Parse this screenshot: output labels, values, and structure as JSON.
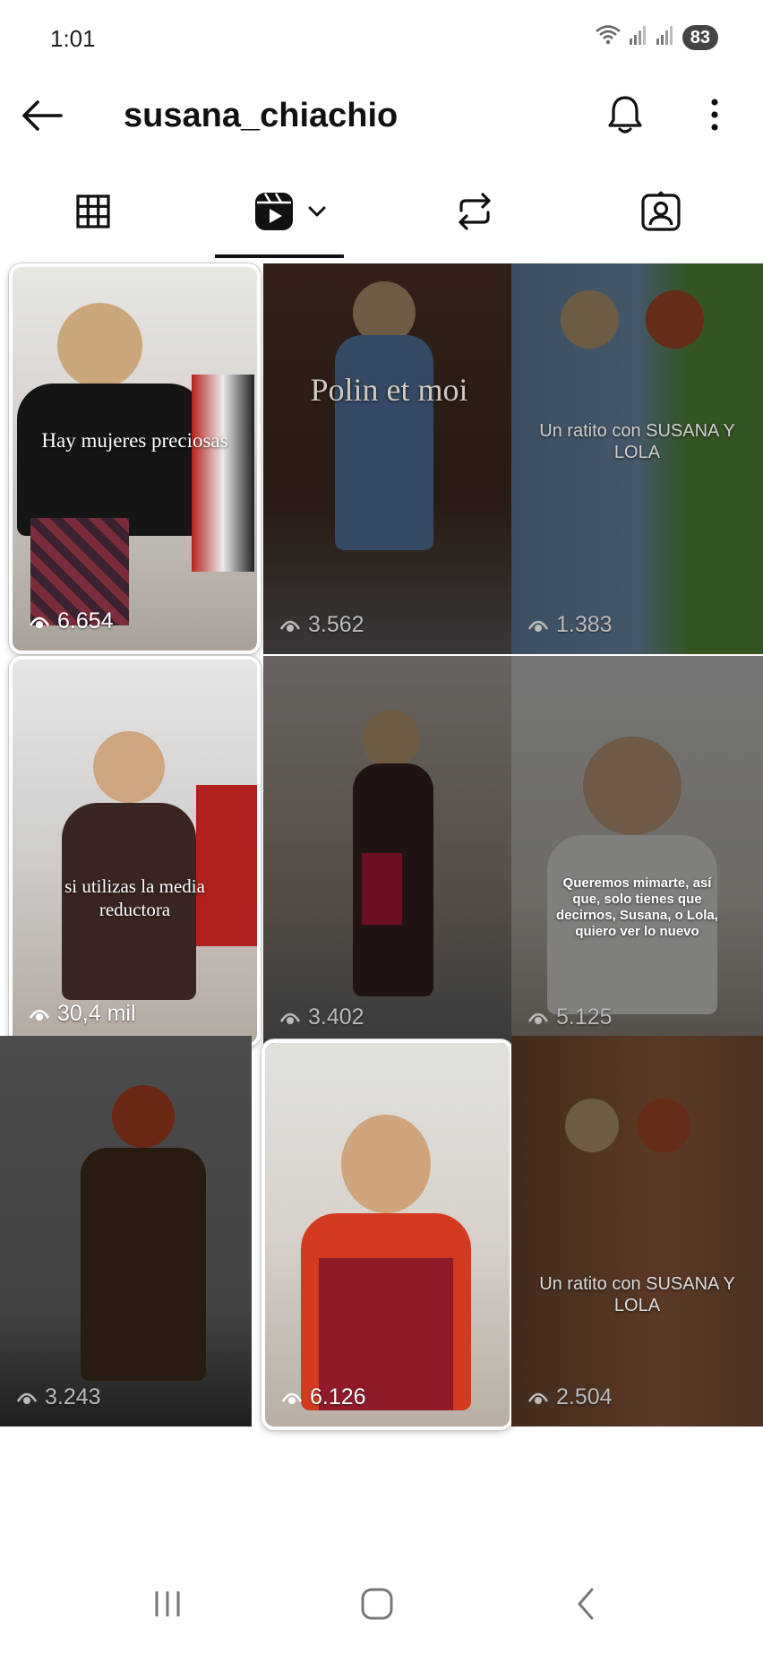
{
  "status_bar": {
    "time": "1:01",
    "battery": "83"
  },
  "header": {
    "username": "susana_chiachio"
  },
  "tabs": [
    {
      "name": "grid-icon"
    },
    {
      "name": "reels-icon"
    },
    {
      "name": "reposts-icon"
    },
    {
      "name": "tagged-icon"
    }
  ],
  "reels": [
    {
      "overlay": "Hay mujeres preciosas",
      "views": "6.654",
      "highlighted": true
    },
    {
      "overlay": "Polin et moi",
      "views": "3.562",
      "highlighted": false
    },
    {
      "overlay": "Un ratito con SUSANA Y LOLA",
      "views": "1.383",
      "highlighted": false
    },
    {
      "overlay": "si utilizas la media reductora",
      "views": "30,4 mil",
      "highlighted": true
    },
    {
      "overlay": "",
      "views": "3.402",
      "highlighted": false
    },
    {
      "overlay": "Queremos mimarte, así que, solo tienes que decirnos, Susana, o Lola, quiero ver lo nuevo",
      "views": "5.125",
      "highlighted": false
    },
    {
      "overlay": "",
      "views": "3.243",
      "highlighted": false
    },
    {
      "overlay": "",
      "views": "6.126",
      "highlighted": true
    },
    {
      "overlay": "Un ratito con SUSANA Y LOLA",
      "views": "2.504",
      "highlighted": false
    }
  ],
  "colors": {
    "accent": "#111111",
    "dim_overlay": "#000000"
  }
}
